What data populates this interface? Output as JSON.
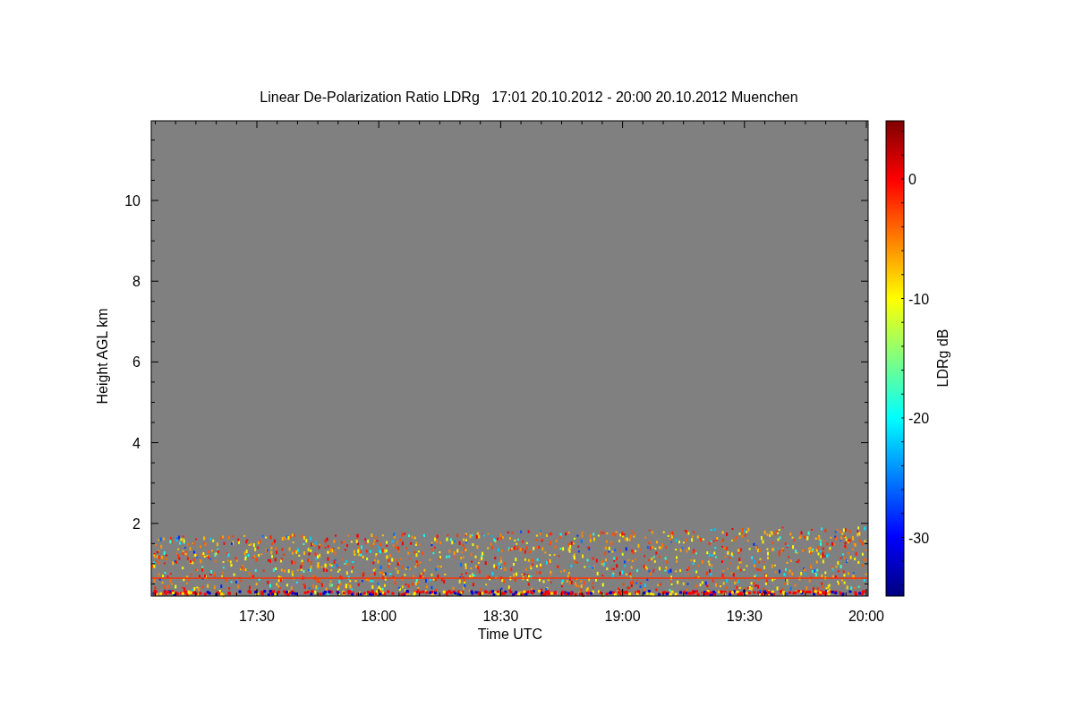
{
  "figure": {
    "title": "Linear De-Polarization Ratio LDRg   17:01 20.10.2012 - 20:00 20.10.2012 Muenchen",
    "xlabel": "Time UTC",
    "ylabel": "Height AGL km",
    "xtick_labels": [
      "17:30",
      "18:00",
      "18:30",
      "19:00",
      "19:30",
      "20:00"
    ],
    "ytick_labels": [
      "10",
      "8",
      "6",
      "4",
      "2"
    ],
    "colorbar": {
      "label": "LDRg dB",
      "tick_labels": [
        "0",
        "-10",
        "-20",
        "-30"
      ]
    }
  }
}
